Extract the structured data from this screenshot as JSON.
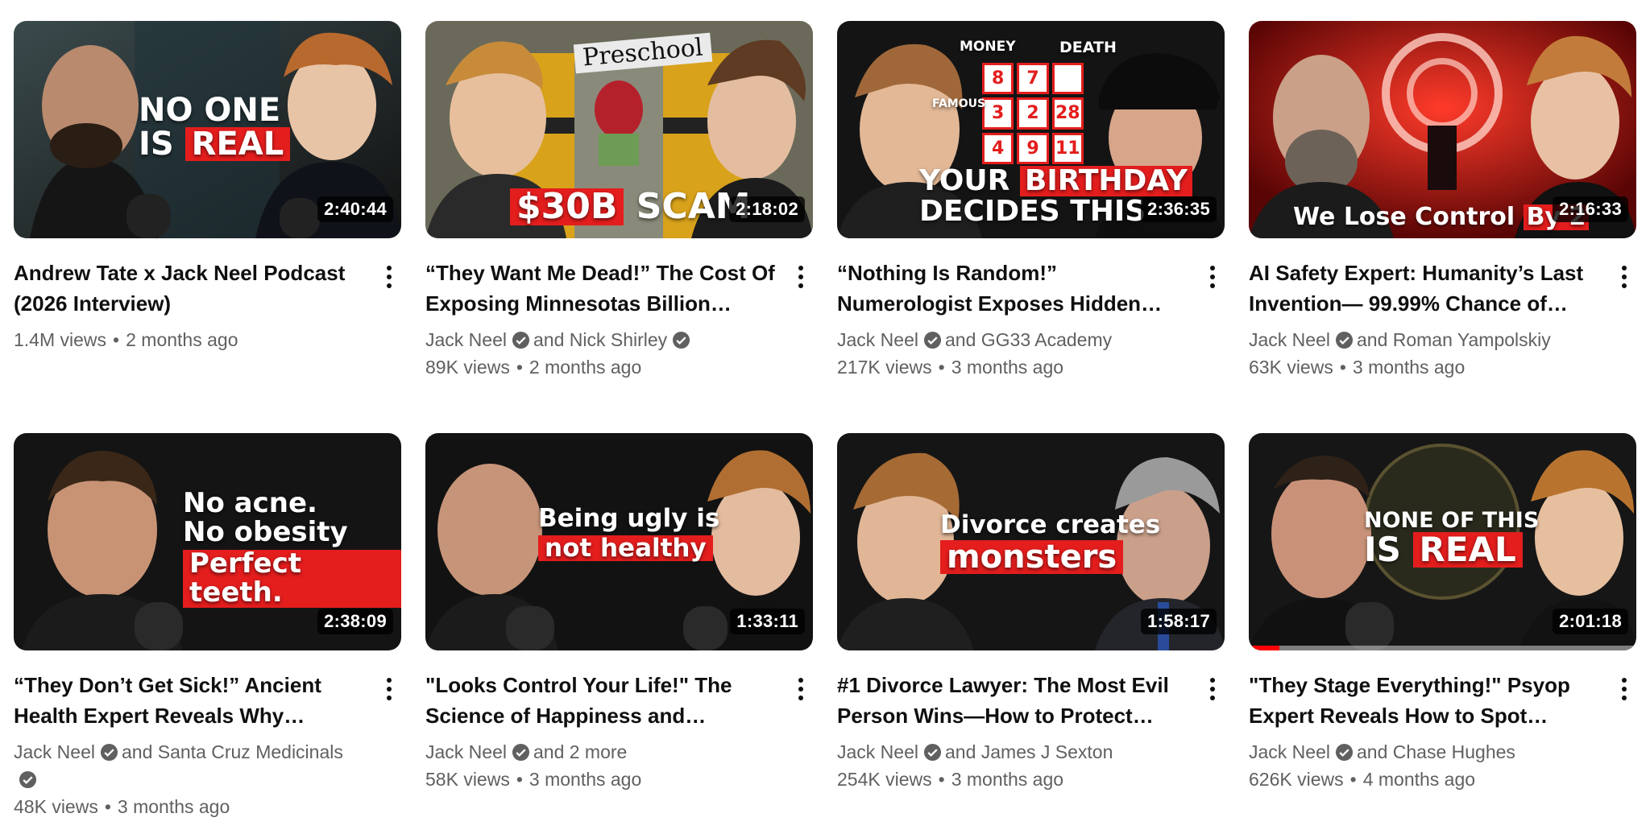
{
  "videos": [
    {
      "title": "Andrew Tate x Jack Neel Podcast (2026 Interview)",
      "duration": "2:40:44",
      "channel": "",
      "collab": "",
      "views": "1.4M views",
      "age": "2 months ago",
      "thumb_lines": [
        "NO ONE",
        "IS",
        "REAL"
      ]
    },
    {
      "title": "“They Want Me Dead!” The Cost Of Exposing Minnesotas Billion Dollar…",
      "duration": "2:18:02",
      "channel": "Jack Neel",
      "collab": "and Nick Shirley",
      "views": "89K views",
      "age": "2 months ago",
      "thumb_lines": [
        "$30B",
        "SCAM",
        "Preschool"
      ]
    },
    {
      "title": "“Nothing Is Random!” Numerologist Exposes Hidden Code Elites Use t…",
      "duration": "2:36:35",
      "channel": "Jack Neel",
      "collab": "and GG33 Academy",
      "views": "217K views",
      "age": "3 months ago",
      "thumb_lines": [
        "YOUR",
        "BIRTHDAY",
        "DECIDES THIS",
        "MONEY",
        "DEATH",
        "FAMOUS"
      ],
      "grid_numbers": [
        "8",
        "7",
        "",
        "3",
        "2",
        "28",
        "4",
        "9",
        "11"
      ]
    },
    {
      "title": "AI Safety Expert: Humanity’s Last Invention— 99.99% Chance of…",
      "duration": "2:16:33",
      "channel": "Jack Neel",
      "collab": "and Roman Yampolskiy",
      "views": "63K views",
      "age": "3 months ago",
      "thumb_lines": [
        "We Lose Control",
        "By 2"
      ]
    },
    {
      "title": "“They Don’t Get Sick!” Ancient Health Expert Reveals Why Moder…",
      "duration": "2:38:09",
      "channel": "Jack Neel",
      "collab": "and Santa Cruz Medicinals",
      "views": "48K views",
      "age": "3 months ago",
      "thumb_lines": [
        "No acne.",
        "No obesity",
        "Perfect teeth."
      ]
    },
    {
      "title": "\"Looks Control Your Life!\" The Science of Happiness and…",
      "duration": "1:33:11",
      "channel": "Jack Neel",
      "collab": "and 2 more",
      "views": "58K views",
      "age": "3 months ago",
      "thumb_lines": [
        "Being ugly is",
        "not healthy"
      ]
    },
    {
      "title": "#1 Divorce Lawyer: The Most Evil Person Wins—How to Protect…",
      "duration": "1:58:17",
      "channel": "Jack Neel",
      "collab": "and James J Sexton",
      "views": "254K views",
      "age": "3 months ago",
      "thumb_lines": [
        "Divorce creates",
        "monsters"
      ]
    },
    {
      "title": "\"They Stage Everything!\" Psyop Expert Reveals How to Spot…",
      "duration": "2:01:18",
      "channel": "Jack Neel",
      "collab": "and Chase Hughes",
      "views": "626K views",
      "age": "4 months ago",
      "watched_fraction": 0.08,
      "thumb_lines": [
        "NONE OF THIS",
        "IS",
        "REAL"
      ]
    }
  ],
  "colors": {
    "accent_red": "#e41d1d",
    "text_primary": "#0f0f0f",
    "text_secondary": "#606060",
    "progress_red": "#ff0000"
  },
  "icons": {
    "verified": "verified-badge-icon",
    "more": "more-vert-icon"
  }
}
